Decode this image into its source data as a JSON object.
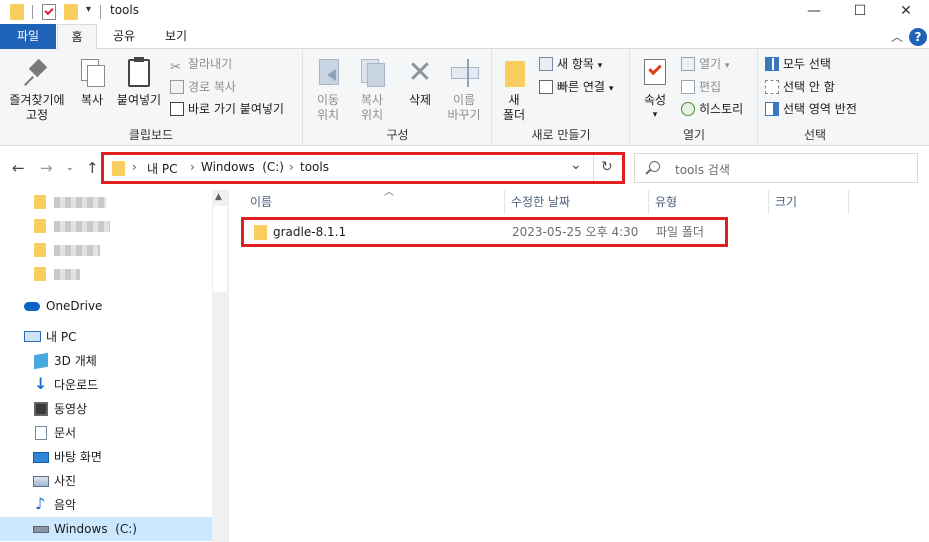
{
  "window": {
    "title": "tools",
    "minimize": "—",
    "maximize": "☐",
    "close": "✕"
  },
  "ribbon_tabs": [
    {
      "label": "파일"
    },
    {
      "label": "홈"
    },
    {
      "label": "공유"
    },
    {
      "label": "보기"
    }
  ],
  "ribbon": {
    "clipboard": {
      "pin_line1": "즐겨찾기에",
      "pin_line2": "고정",
      "copy": "복사",
      "paste": "붙여넣기",
      "cut": "잘라내기",
      "copy_path": "경로 복사",
      "paste_shortcut": "바로 가기 붙여넣기",
      "group_label": "클립보드"
    },
    "organize": {
      "move_line1": "이동",
      "move_line2": "위치",
      "copyto_line1": "복사",
      "copyto_line2": "위치",
      "delete": "삭제",
      "rename_line1": "이름",
      "rename_line2": "바꾸기",
      "group_label": "구성"
    },
    "new": {
      "new_folder_line1": "새",
      "new_folder_line2": "폴더",
      "new_item": "새 항목",
      "easy_access": "빠른 연결",
      "group_label": "새로 만들기"
    },
    "open": {
      "properties": "속성",
      "open": "열기",
      "edit": "편집",
      "history": "히스토리",
      "group_label": "열기"
    },
    "select": {
      "select_all": "모두 선택",
      "select_none": "선택 안 함",
      "invert": "선택 영역 반전",
      "group_label": "선택"
    }
  },
  "address": {
    "crumbs": [
      "내 PC",
      "Windows  (C:)",
      "tools"
    ],
    "refresh": "↻",
    "dropdown": "⌄"
  },
  "search": {
    "placeholder": "tools 검색"
  },
  "sidebar": {
    "onedrive": "OneDrive",
    "thispc": "내 PC",
    "items": [
      {
        "label": "3D 개체",
        "icon": "3d-objects-icon"
      },
      {
        "label": "다운로드",
        "icon": "downloads-icon"
      },
      {
        "label": "동영상",
        "icon": "videos-icon"
      },
      {
        "label": "문서",
        "icon": "documents-icon"
      },
      {
        "label": "바탕 화면",
        "icon": "desktop-icon"
      },
      {
        "label": "사진",
        "icon": "pictures-icon"
      },
      {
        "label": "음악",
        "icon": "music-icon"
      },
      {
        "label": "Windows  (C:)",
        "icon": "drive-icon"
      }
    ]
  },
  "columns": {
    "name": "이름",
    "date": "수정한 날짜",
    "type": "유형",
    "size": "크기"
  },
  "files": [
    {
      "name": "gradle-8.1.1",
      "date": "2023-05-25 오후 4:30",
      "type": "파일 폴더",
      "size": ""
    }
  ],
  "colors": {
    "accent": "#1e63b7",
    "highlight_box": "#e02020",
    "selected": "#cce8ff",
    "folder": "#f8cf5f"
  }
}
